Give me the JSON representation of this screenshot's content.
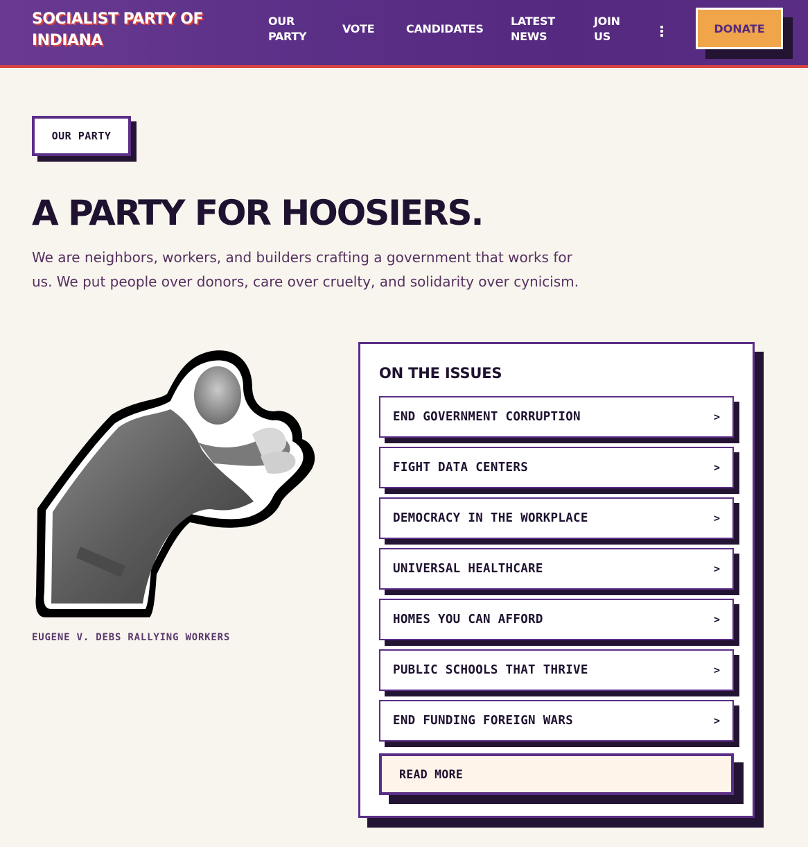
{
  "header": {
    "brand_line1": "SOCIALIST PARTY OF",
    "brand_line2": "INDIANA",
    "nav": [
      {
        "line1": "OUR",
        "line2": "PARTY"
      },
      {
        "line1": "VOTE",
        "line2": ""
      },
      {
        "line1": "CANDIDATES",
        "line2": ""
      },
      {
        "line1": "LATEST",
        "line2": "NEWS"
      },
      {
        "line1": "JOIN",
        "line2": "US"
      }
    ],
    "more_icon": "kebab-menu-icon",
    "donate_label": "DONATE"
  },
  "hero": {
    "tag": "OUR PARTY",
    "headline": "A PARTY FOR HOOSIERS.",
    "intro": "We are neighbors, workers, and builders crafting a government that works for us. We put people over donors, care over cruelty, and solidarity over cynicism."
  },
  "figure": {
    "caption": "EUGENE V. DEBS RALLYING WORKERS"
  },
  "issues": {
    "title": "ON THE ISSUES",
    "items": [
      "END GOVERNMENT CORRUPTION",
      "FIGHT DATA CENTERS",
      "DEMOCRACY IN THE WORKPLACE",
      "UNIVERSAL HEALTHCARE",
      "HOMES YOU CAN AFFORD",
      "PUBLIC SCHOOLS THAT THRIVE",
      "END FUNDING FOREIGN WARS"
    ],
    "chevron": ">",
    "read_more": "READ MORE"
  },
  "colors": {
    "header_purple": "#5a2f86",
    "accent_red": "#d9453f",
    "donate_orange": "#f0a54a",
    "border_purple": "#5b2e87",
    "shadow_dark": "#241433",
    "page_bg": "#f8f4ee"
  }
}
